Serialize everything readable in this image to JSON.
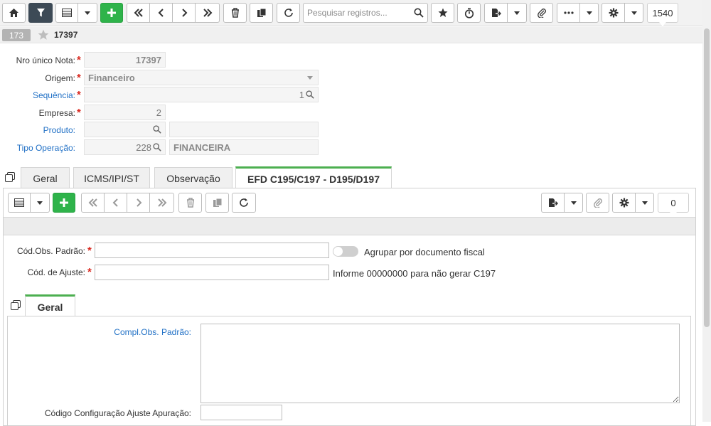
{
  "toolbar": {
    "search_placeholder": "Pesquisar registros...",
    "record_count": "1540"
  },
  "record": {
    "id": "173",
    "number": "17397"
  },
  "form": {
    "nro_unico": {
      "label": "Nro único Nota:",
      "value": "17397"
    },
    "origem": {
      "label": "Origem:",
      "value": "Financeiro"
    },
    "sequencia": {
      "label": "Sequência:",
      "value": "1"
    },
    "empresa": {
      "label": "Empresa:",
      "value": "2"
    },
    "produto": {
      "label": "Produto:",
      "code": "",
      "desc": ""
    },
    "tipo_operacao": {
      "label": "Tipo Operação:",
      "code": "228",
      "desc": "FINANCEIRA"
    }
  },
  "tabs": [
    {
      "label": "Geral"
    },
    {
      "label": "ICMS/IPI/ST"
    },
    {
      "label": "Observação"
    },
    {
      "label": "EFD C195/C197 - D195/D197"
    }
  ],
  "detail": {
    "record_count": "0",
    "cod_obs_padrao": {
      "label": "Cód.Obs. Padrão:",
      "value": ""
    },
    "cod_ajuste": {
      "label": "Cód. de Ajuste:",
      "value": ""
    },
    "agrupar_label": "Agrupar por documento fiscal",
    "agrupar_on": false,
    "informe_note": "Informe 00000000 para não gerar C197"
  },
  "subtabs": [
    {
      "label": "Geral"
    }
  ],
  "sub": {
    "compl_obs_label": "Compl.Obs. Padrão:",
    "compl_obs_value": "",
    "codigo_config_label": "Código Configuração Ajuste Apuração:",
    "codigo_config_value": ""
  },
  "colors": {
    "accent_green": "#2eb34a",
    "tab_active_border": "#4caf50",
    "link_blue": "#1f6fc5",
    "required_red": "#d9281f",
    "dark_button": "#3d4a56"
  }
}
